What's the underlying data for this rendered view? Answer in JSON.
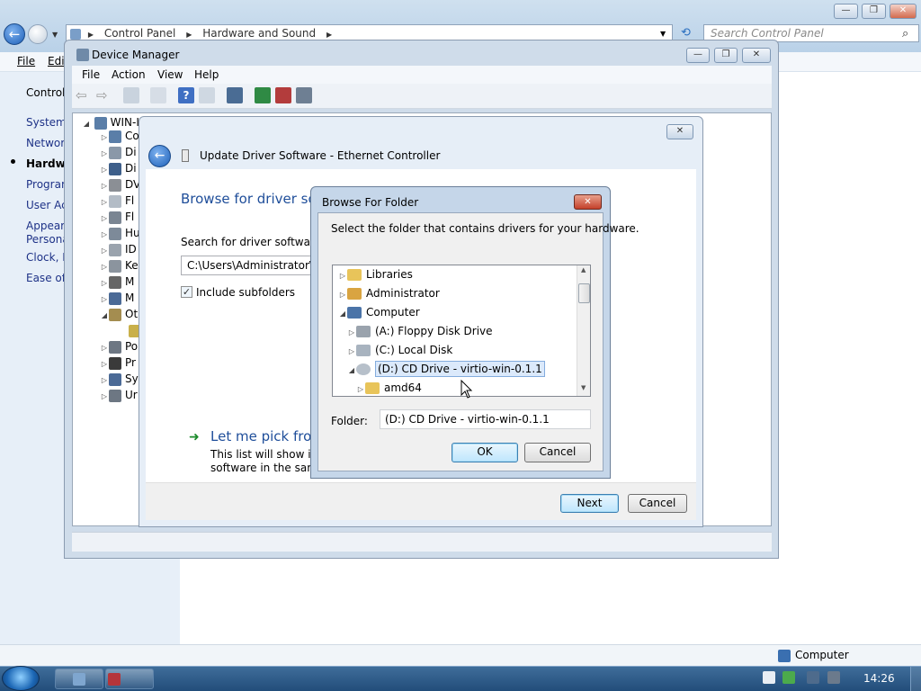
{
  "control_panel": {
    "breadcrumb": [
      "Control Panel",
      "Hardware and Sound"
    ],
    "search_placeholder": "Search Control Panel",
    "menu": [
      "File",
      "Edi"
    ],
    "nav": [
      "Control",
      "System",
      "Network",
      "Hardwa",
      "Program",
      "User Acc",
      "Appeara",
      "Persona",
      "Clock, L",
      "Ease of A"
    ],
    "status_text": "Computer"
  },
  "device_manager": {
    "title": "Device Manager",
    "menu": [
      "File",
      "Action",
      "View",
      "Help"
    ],
    "tree_root": "WIN-I",
    "tree_items": [
      "Co",
      "Di",
      "Di",
      "DV",
      "Fl",
      "Fl",
      "Hu",
      "ID",
      "Ke",
      "M",
      "M",
      "Ot",
      "",
      "Po",
      "Pr",
      "Sy",
      "Ur"
    ]
  },
  "update_driver": {
    "title": "Update Driver Software - Ethernet Controller",
    "heading": "Browse for driver sof",
    "search_label": "Search for driver software in",
    "path_value": "C:\\Users\\Administrator\\De",
    "include_subfolders": "Include subfolders",
    "pick_title": "Let me pick from",
    "pick_desc_1": "This list will show inst",
    "pick_desc_2": "software in the same",
    "next": "Next",
    "cancel": "Cancel"
  },
  "browse_folder": {
    "title": "Browse For Folder",
    "prompt": "Select the folder that contains drivers for your hardware.",
    "items": [
      "Libraries",
      "Administrator",
      "Computer",
      "(A:) Floppy Disk Drive",
      "(C:) Local Disk",
      "(D:) CD Drive - virtio-win-0.1.1",
      "amd64"
    ],
    "folder_label": "Folder:",
    "folder_value": "(D:) CD Drive - virtio-win-0.1.1",
    "ok": "OK",
    "cancel": "Cancel"
  },
  "taskbar": {
    "time": "14:26"
  },
  "colors": {
    "link": "#1e3287",
    "heading": "#1f4e9a",
    "selection": "#dbe9fb"
  }
}
